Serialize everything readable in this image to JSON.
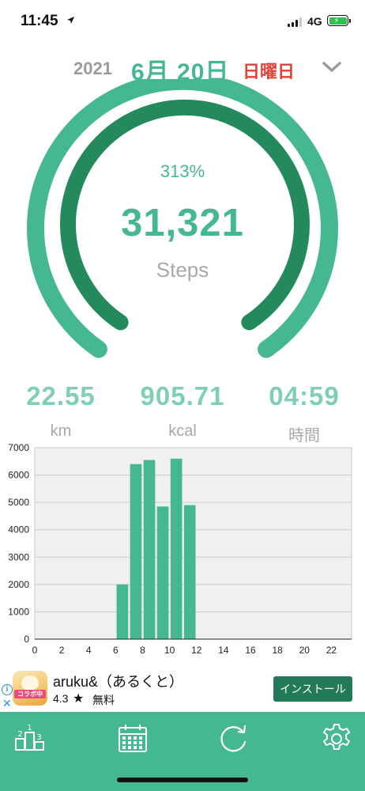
{
  "status_bar": {
    "time": "11:45",
    "network": "4G"
  },
  "date_header": {
    "year": "2021",
    "month_day": "6月 20日",
    "weekday": "日曜日"
  },
  "gauge": {
    "percent": "313%",
    "steps": "31,321",
    "unit": "Steps",
    "progress": 1.0
  },
  "stats": [
    {
      "value": "22.55",
      "label": "km"
    },
    {
      "value": "905.71",
      "label": "kcal"
    },
    {
      "value": "04:59",
      "label": "時間"
    }
  ],
  "chart_data": {
    "type": "bar",
    "x": [
      6,
      7,
      8,
      9,
      10,
      11
    ],
    "values": [
      2000,
      6400,
      6550,
      4850,
      6600,
      4900
    ],
    "x_ticks": [
      "0",
      "2",
      "4",
      "6",
      "8",
      "10",
      "12",
      "14",
      "16",
      "18",
      "20",
      "22"
    ],
    "y_ticks": [
      "0",
      "1000",
      "2000",
      "3000",
      "4000",
      "5000",
      "6000",
      "7000"
    ],
    "xlim": [
      0,
      23.5
    ],
    "ylim": [
      0,
      7000
    ],
    "grid": true,
    "bar_color": "#45b891"
  },
  "ad": {
    "app_name": "aruku&（あるくと）",
    "rating": "4.3",
    "price": "無料",
    "install_label": "インストール",
    "icon_tag": "コラボ中"
  },
  "tabs": [
    {
      "icon": "ranking-icon"
    },
    {
      "icon": "calendar-icon"
    },
    {
      "icon": "refresh-icon"
    },
    {
      "icon": "gear-icon"
    }
  ],
  "colors": {
    "accent": "#45b891",
    "accent_dark": "#248a5e",
    "weekday": "#e0413a",
    "stat": "#7fcfb0"
  }
}
